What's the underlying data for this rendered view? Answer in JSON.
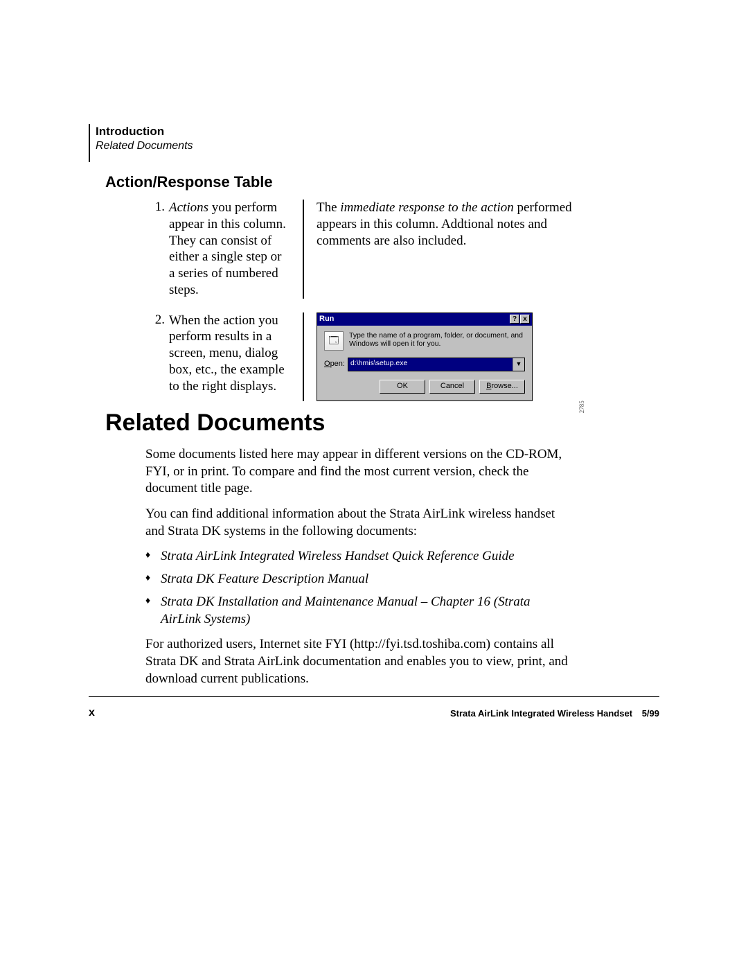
{
  "header": {
    "chapter": "Introduction",
    "subsection": "Related Documents"
  },
  "section_title": "Action/Response Table",
  "rows": [
    {
      "num": "1.",
      "action_prefix_italic": "Actions",
      "action_rest": " you perform appear in this column. They can consist of either a single step or a series of numbered steps.",
      "response_pre": "The ",
      "response_italic": "immediate response to the action",
      "response_post": " performed appears in this column. Addtional notes and comments are also included."
    },
    {
      "num": "2.",
      "action_full": "When the action you perform results in a screen, menu, dialog box, etc., the example to the right displays."
    }
  ],
  "run_dialog": {
    "title": "Run",
    "help_btn": "?",
    "close_btn": "x",
    "message": "Type the name of a program, folder, or document, and Windows will open it for you.",
    "open_label_u": "O",
    "open_label_rest": "pen:",
    "open_value": "d:\\hmis\\setup.exe",
    "btn_ok": "OK",
    "btn_cancel": "Cancel",
    "btn_browse_u": "B",
    "btn_browse_rest": "rowse...",
    "image_num": "2785"
  },
  "main_heading": "Related Documents",
  "paragraphs": {
    "p1": "Some documents listed here may appear in different versions on the CD-ROM, FYI, or in print. To compare and find the most current version, check the document title page.",
    "p2": "You can find additional information about the Strata AirLink wireless handset and Strata DK systems in the following documents:",
    "p3": "For authorized users, Internet site FYI (http://fyi.tsd.toshiba.com) contains all Strata DK and Strata AirLink documentation and enables you to view, print, and download current publications."
  },
  "doc_list": [
    "Strata AirLink Integrated Wireless Handset Quick Reference Guide",
    "Strata DK Feature Description Manual",
    "Strata DK Installation and Maintenance Manual – Chapter 16 (Strata AirLink Systems)"
  ],
  "footer": {
    "page": "x",
    "title": "Strata AirLink Integrated Wireless Handset",
    "date": "5/99"
  }
}
